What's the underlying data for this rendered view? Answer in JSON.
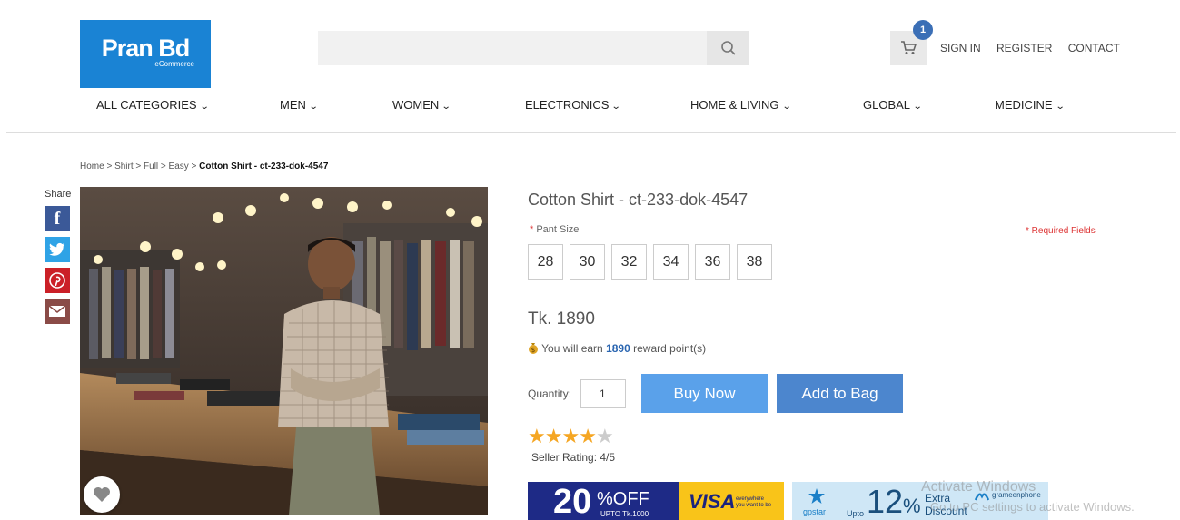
{
  "header": {
    "logo_title": "Pran Bd",
    "logo_subtitle": "eCommerce",
    "search_placeholder": "",
    "cart_count": "1",
    "links": [
      "SIGN IN",
      "REGISTER",
      "CONTACT"
    ]
  },
  "nav": {
    "items": [
      "ALL CATEGORIES",
      "MEN",
      "WOMEN",
      "ELECTRONICS",
      "HOME & LIVING",
      "GLOBAL",
      "MEDICINE"
    ]
  },
  "breadcrumb": {
    "trail": "Home > Shirt > Full > Easy > ",
    "current": "Cotton Shirt - ct-233-dok-4547"
  },
  "share": {
    "label": "Share",
    "icons": [
      "facebook-icon",
      "twitter-icon",
      "pinterest-icon",
      "email-icon"
    ]
  },
  "product": {
    "title": "Cotton Shirt - ct-233-dok-4547",
    "size_label_star": "*",
    "size_label": "Pant Size",
    "required_note": "* Required Fields",
    "sizes": [
      "28",
      "30",
      "32",
      "34",
      "36",
      "38"
    ],
    "price": "Tk. 1890",
    "reward_prefix": "You will earn",
    "reward_points": "1890",
    "reward_suffix": "reward point(s)",
    "quantity_label": "Quantity:",
    "quantity_value": "1",
    "buy_now": "Buy Now",
    "add_to_bag": "Add to Bag",
    "rating": 4,
    "rating_max": 5,
    "seller_rating": "Seller Rating: 4/5"
  },
  "banners": {
    "visa": {
      "percent": "20",
      "off": "%OFF",
      "upto": "UPTO Tk.1000",
      "brand": "VISA",
      "tagline_1": "everywhere",
      "tagline_2": "you want to be"
    },
    "gp": {
      "brand": "gpstar",
      "upto": "Upto",
      "percent": "12",
      "extra": "Extra",
      "discount": "Discount",
      "partner": "grameenphone"
    }
  },
  "watermark": {
    "line1": "Activate Windows",
    "line2": "Go to PC settings to activate Windows."
  },
  "colors": {
    "brand_blue": "#1a83d4",
    "buy_now": "#5aa1ea",
    "add_to_bag": "#4c86ce",
    "required": "#d33333",
    "star": "#f5a623"
  }
}
